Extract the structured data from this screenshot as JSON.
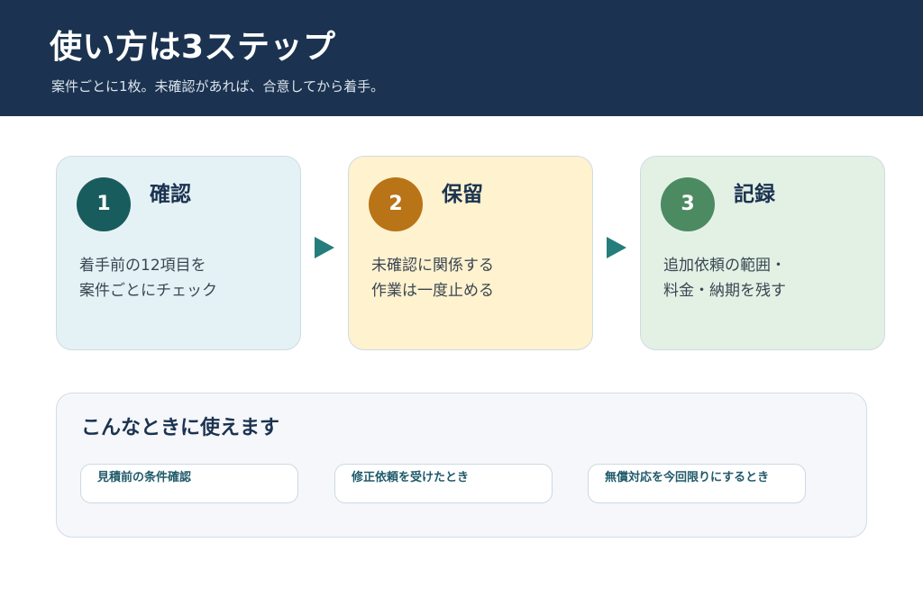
{
  "header": {
    "title": "使い方は3ステップ",
    "subtitle": "案件ごとに1枚。未確認があれば、合意してから着手。"
  },
  "steps": [
    {
      "number": "1",
      "title": "確認",
      "lines": [
        "着手前の12項目を",
        "案件ごとにチェック"
      ],
      "color": "#195c5e",
      "background": "#e5f2f5"
    },
    {
      "number": "2",
      "title": "保留",
      "lines": [
        "未確認に関係する",
        "作業は一度止める"
      ],
      "color": "#b87417",
      "background": "#fff2cf"
    },
    {
      "number": "3",
      "title": "記録",
      "lines": [
        "追加依頼の範囲・",
        "料金・納期を残す"
      ],
      "color": "#4c8a62",
      "background": "#e3f1e5"
    }
  ],
  "use_cases": {
    "title": "こんなときに使えます",
    "items": [
      "見積前の条件確認",
      "修正依頼を受けたとき",
      "無償対応を今回限りにするとき"
    ]
  },
  "colors": {
    "header_bg": "#1b3350",
    "arrow": "#257d7c",
    "chip_text": "#1f5a6a"
  },
  "icons": {
    "step_arrow": "triangle-right-icon"
  }
}
